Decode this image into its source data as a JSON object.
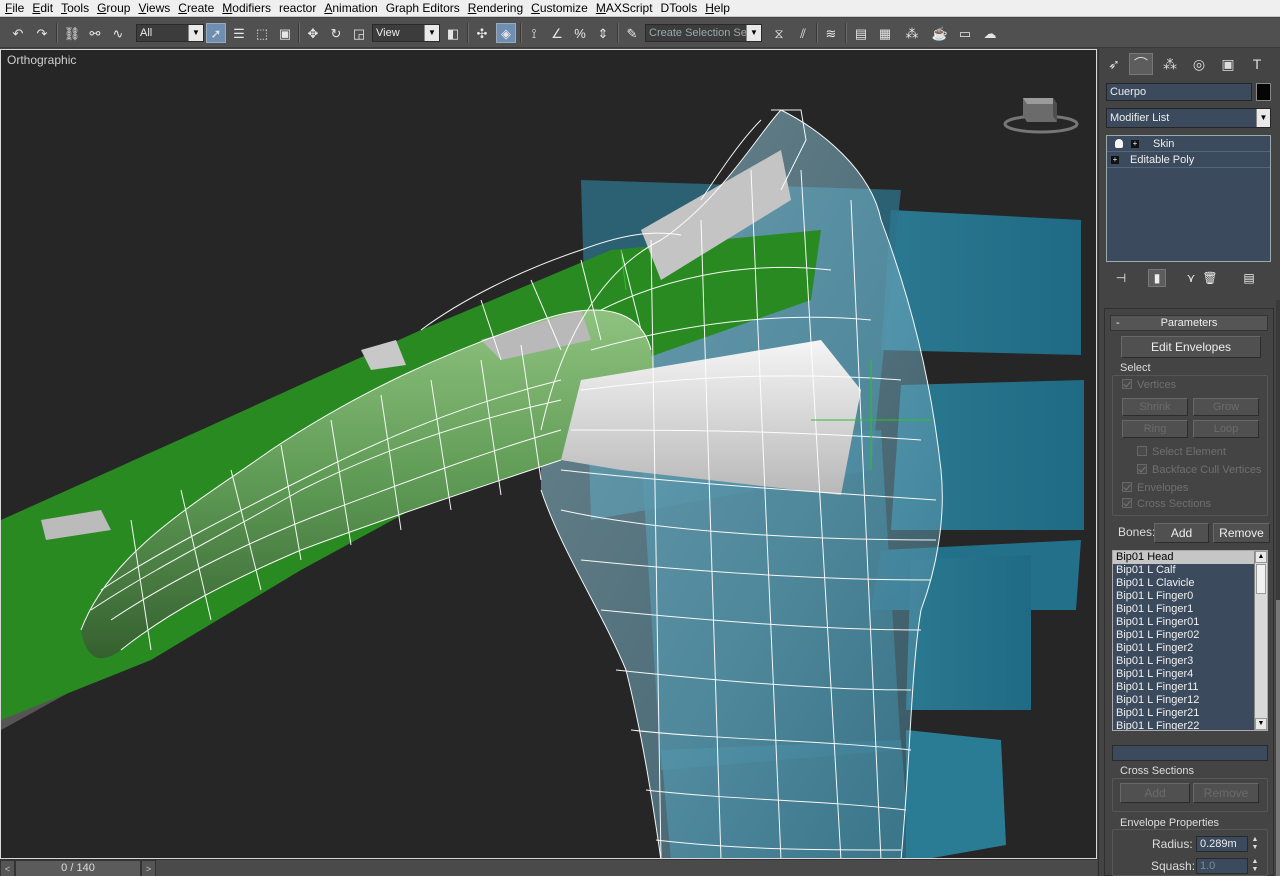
{
  "menu": [
    {
      "label": "File",
      "u": "F",
      "rest": "ile"
    },
    {
      "label": "Edit",
      "u": "E",
      "rest": "dit"
    },
    {
      "label": "Tools",
      "u": "T",
      "rest": "ools"
    },
    {
      "label": "Group",
      "u": "G",
      "rest": "roup"
    },
    {
      "label": "Views",
      "u": "V",
      "rest": "iews"
    },
    {
      "label": "Create",
      "u": "C",
      "rest": "reate"
    },
    {
      "label": "Modifiers",
      "u": "M",
      "rest": "odifiers"
    },
    {
      "label": "reactor",
      "u": "",
      "rest": "reactor"
    },
    {
      "label": "Animation",
      "u": "A",
      "rest": "nimation"
    },
    {
      "label": "Graph Editors",
      "u": "",
      "rest": "Graph Editors"
    },
    {
      "label": "Rendering",
      "u": "R",
      "rest": "endering"
    },
    {
      "label": "Customize",
      "u": "C",
      "rest": "ustomize"
    },
    {
      "label": "MAXScript",
      "u": "M",
      "rest": "AXScript"
    },
    {
      "label": "DTools",
      "u": "",
      "rest": "DTools"
    },
    {
      "label": "Help",
      "u": "H",
      "rest": "elp"
    }
  ],
  "toolbar": {
    "selection_filter": "All",
    "ref_coord": "View",
    "named_selection_placeholder": "Create Selection Se"
  },
  "viewport": {
    "label": "Orthographic"
  },
  "timeslider": {
    "frame": "0 / 140",
    "prev": "<",
    "next": ">"
  },
  "command_panel": {
    "object_name": "Cuerpo",
    "object_color": "#050505",
    "modifier_list": "Modifier List",
    "stack": [
      {
        "label": "Skin"
      },
      {
        "label": "Editable Poly"
      }
    ],
    "parameters": {
      "title": "Parameters",
      "collapse": "-",
      "edit_envelopes": "Edit Envelopes",
      "select_group": "Select",
      "vertices": "Vertices",
      "shrink": "Shrink",
      "grow": "Grow",
      "ring": "Ring",
      "loop": "Loop",
      "select_element": "Select Element",
      "backface_cull": "Backface Cull Vertices",
      "envelopes": "Envelopes",
      "cross_sections_chk": "Cross Sections",
      "bones_label": "Bones:",
      "add": "Add",
      "remove": "Remove",
      "bones": [
        "Bip01 Head",
        "Bip01 L Calf",
        "Bip01 L Clavicle",
        "Bip01 L Finger0",
        "Bip01 L Finger1",
        "Bip01 L Finger01",
        "Bip01 L Finger02",
        "Bip01 L Finger2",
        "Bip01 L Finger3",
        "Bip01 L Finger4",
        "Bip01 L Finger11",
        "Bip01 L Finger12",
        "Bip01 L Finger21",
        "Bip01 L Finger22"
      ],
      "cross_sections": "Cross Sections",
      "cs_add": "Add",
      "cs_remove": "Remove",
      "envelope_properties": "Envelope Properties",
      "radius_label": "Radius:",
      "radius": "0.289m",
      "squash_label": "Squash:",
      "squash": "1.0"
    }
  },
  "colors": {
    "viewport_bg": "#262626",
    "ui_bg": "#444444",
    "field_bg": "#3b4a5c",
    "mesh_green": "#2f8f2a",
    "mesh_cyan": "#2b7f99",
    "wire": "#ffffff"
  }
}
